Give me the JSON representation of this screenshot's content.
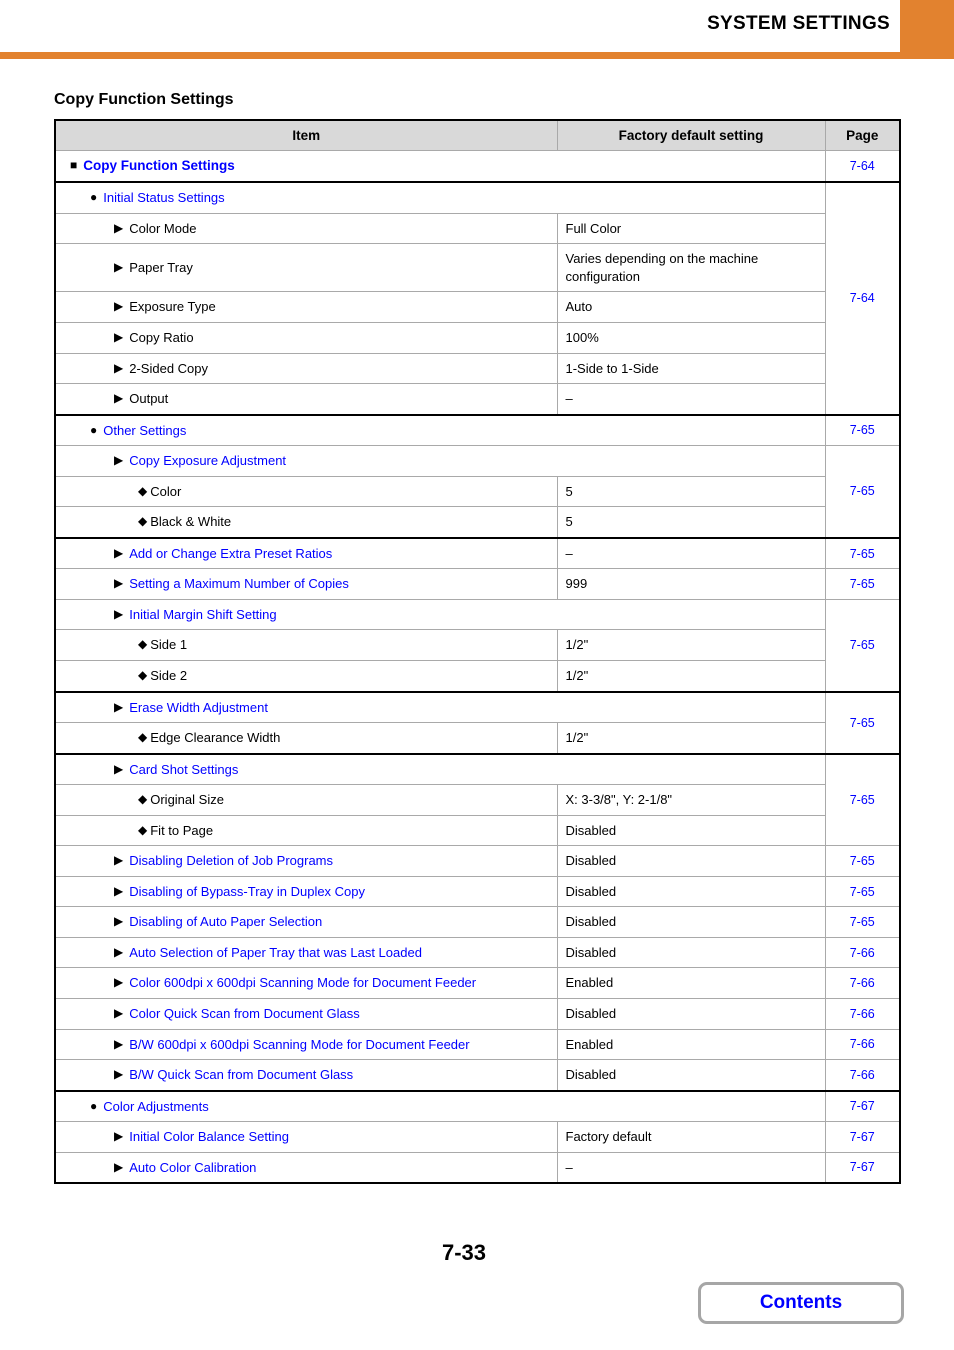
{
  "header": {
    "title": "SYSTEM SETTINGS",
    "accent_color": "#E2822F"
  },
  "section": {
    "title": "Copy Function Settings"
  },
  "table": {
    "columns": {
      "item": "Item",
      "value": "Factory default setting",
      "page": "Page"
    },
    "link_color": "#0000FF",
    "rows": [
      {
        "level": 1,
        "marker": "square",
        "label": "Copy Function Settings",
        "link": true,
        "value": null,
        "span": true,
        "page": "7-64",
        "page_rowspan": 1,
        "group_sep": false
      },
      {
        "level": 2,
        "marker": "circle",
        "label": "Initial Status Settings",
        "link": true,
        "value": null,
        "span": true,
        "page": "7-64",
        "page_rowspan": 7,
        "group_sep": true
      },
      {
        "level": 3,
        "marker": "triangle",
        "label": "Color Mode",
        "link": false,
        "value": "Full Color",
        "span": false,
        "page": null,
        "page_rowspan": 0,
        "group_sep": false
      },
      {
        "level": 3,
        "marker": "triangle",
        "label": "Paper Tray",
        "link": false,
        "value": "Varies depending on the machine configuration",
        "span": false,
        "page": null,
        "page_rowspan": 0,
        "group_sep": false
      },
      {
        "level": 3,
        "marker": "triangle",
        "label": "Exposure Type",
        "link": false,
        "value": "Auto",
        "span": false,
        "page": null,
        "page_rowspan": 0,
        "group_sep": false
      },
      {
        "level": 3,
        "marker": "triangle",
        "label": "Copy Ratio",
        "link": false,
        "value": "100%",
        "span": false,
        "page": null,
        "page_rowspan": 0,
        "group_sep": false
      },
      {
        "level": 3,
        "marker": "triangle",
        "label": "2-Sided Copy",
        "link": false,
        "value": "1-Side to 1-Side",
        "span": false,
        "page": null,
        "page_rowspan": 0,
        "group_sep": false
      },
      {
        "level": 3,
        "marker": "triangle",
        "label": "Output",
        "link": false,
        "value": "–",
        "span": false,
        "page": null,
        "page_rowspan": 0,
        "group_sep": false
      },
      {
        "level": 2,
        "marker": "circle",
        "label": "Other Settings",
        "link": true,
        "value": null,
        "span": true,
        "page": "7-65",
        "page_rowspan": 1,
        "group_sep": true
      },
      {
        "level": 3,
        "marker": "triangle",
        "label": "Copy Exposure Adjustment",
        "link": true,
        "value": null,
        "span": true,
        "page": "7-65",
        "page_rowspan": 3,
        "group_sep": false
      },
      {
        "level": 4,
        "marker": "diamond",
        "label": "Color",
        "link": false,
        "value": "5",
        "span": false,
        "page": null,
        "page_rowspan": 0,
        "group_sep": false
      },
      {
        "level": 4,
        "marker": "diamond",
        "label": "Black & White",
        "link": false,
        "value": "5",
        "span": false,
        "page": null,
        "page_rowspan": 0,
        "group_sep": false
      },
      {
        "level": 3,
        "marker": "triangle",
        "label": "Add or Change Extra Preset Ratios",
        "link": true,
        "value": "–",
        "span": false,
        "page": "7-65",
        "page_rowspan": 1,
        "group_sep": true
      },
      {
        "level": 3,
        "marker": "triangle",
        "label": "Setting a Maximum Number of Copies",
        "link": true,
        "value": "999",
        "span": false,
        "page": "7-65",
        "page_rowspan": 1,
        "group_sep": false
      },
      {
        "level": 3,
        "marker": "triangle",
        "label": "Initial Margin Shift Setting",
        "link": true,
        "value": null,
        "span": true,
        "page": "7-65",
        "page_rowspan": 3,
        "group_sep": false
      },
      {
        "level": 4,
        "marker": "diamond",
        "label": "Side 1",
        "link": false,
        "value": "1/2\"",
        "span": false,
        "page": null,
        "page_rowspan": 0,
        "group_sep": false
      },
      {
        "level": 4,
        "marker": "diamond",
        "label": "Side 2",
        "link": false,
        "value": "1/2\"",
        "span": false,
        "page": null,
        "page_rowspan": 0,
        "group_sep": false
      },
      {
        "level": 3,
        "marker": "triangle",
        "label": "Erase Width Adjustment",
        "link": true,
        "value": null,
        "span": true,
        "page": "7-65",
        "page_rowspan": 2,
        "group_sep": true
      },
      {
        "level": 4,
        "marker": "diamond",
        "label": "Edge Clearance Width",
        "link": false,
        "value": "1/2\"",
        "span": false,
        "page": null,
        "page_rowspan": 0,
        "group_sep": false
      },
      {
        "level": 3,
        "marker": "triangle",
        "label": "Card Shot Settings",
        "link": true,
        "value": null,
        "span": true,
        "page": "7-65",
        "page_rowspan": 3,
        "group_sep": true
      },
      {
        "level": 4,
        "marker": "diamond",
        "label": "Original Size",
        "link": false,
        "value": "X: 3-3/8\", Y: 2-1/8\"",
        "span": false,
        "page": null,
        "page_rowspan": 0,
        "group_sep": false
      },
      {
        "level": 4,
        "marker": "diamond",
        "label": "Fit to Page",
        "link": false,
        "value": "Disabled",
        "span": false,
        "page": null,
        "page_rowspan": 0,
        "group_sep": false
      },
      {
        "level": 3,
        "marker": "triangle",
        "label": "Disabling Deletion of Job Programs",
        "link": true,
        "value": "Disabled",
        "span": false,
        "page": "7-65",
        "page_rowspan": 1,
        "group_sep": false
      },
      {
        "level": 3,
        "marker": "triangle",
        "label": "Disabling of Bypass-Tray in Duplex Copy",
        "link": true,
        "value": "Disabled",
        "span": false,
        "page": "7-65",
        "page_rowspan": 1,
        "group_sep": false
      },
      {
        "level": 3,
        "marker": "triangle",
        "label": "Disabling of Auto Paper Selection",
        "link": true,
        "value": "Disabled",
        "span": false,
        "page": "7-65",
        "page_rowspan": 1,
        "group_sep": false
      },
      {
        "level": 3,
        "marker": "triangle",
        "label": "Auto Selection of Paper Tray that was Last Loaded",
        "link": true,
        "value": "Disabled",
        "span": false,
        "page": "7-66",
        "page_rowspan": 1,
        "group_sep": false
      },
      {
        "level": 3,
        "marker": "triangle",
        "label": "Color 600dpi x 600dpi Scanning Mode for Document Feeder",
        "link": true,
        "value": "Enabled",
        "span": false,
        "page": "7-66",
        "page_rowspan": 1,
        "group_sep": false
      },
      {
        "level": 3,
        "marker": "triangle",
        "label": "Color Quick Scan from Document Glass",
        "link": true,
        "value": "Disabled",
        "span": false,
        "page": "7-66",
        "page_rowspan": 1,
        "group_sep": false
      },
      {
        "level": 3,
        "marker": "triangle",
        "label": "B/W 600dpi x 600dpi Scanning Mode for Document Feeder",
        "link": true,
        "value": "Enabled",
        "span": false,
        "page": "7-66",
        "page_rowspan": 1,
        "group_sep": false
      },
      {
        "level": 3,
        "marker": "triangle",
        "label": "B/W Quick Scan from Document Glass",
        "link": true,
        "value": "Disabled",
        "span": false,
        "page": "7-66",
        "page_rowspan": 1,
        "group_sep": false
      },
      {
        "level": 2,
        "marker": "circle",
        "label": "Color Adjustments",
        "link": true,
        "value": null,
        "span": true,
        "page": "7-67",
        "page_rowspan": 1,
        "group_sep": true
      },
      {
        "level": 3,
        "marker": "triangle",
        "label": "Initial Color Balance Setting",
        "link": true,
        "value": "Factory default",
        "span": false,
        "page": "7-67",
        "page_rowspan": 1,
        "group_sep": false
      },
      {
        "level": 3,
        "marker": "triangle",
        "label": "Auto Color Calibration",
        "link": true,
        "value": "–",
        "span": false,
        "page": "7-67",
        "page_rowspan": 1,
        "group_sep": false
      }
    ]
  },
  "footer": {
    "page_number": "7-33",
    "contents_label": "Contents"
  },
  "markers": {
    "square": "■",
    "circle": "●",
    "triangle": "▶",
    "diamond": "◆"
  }
}
